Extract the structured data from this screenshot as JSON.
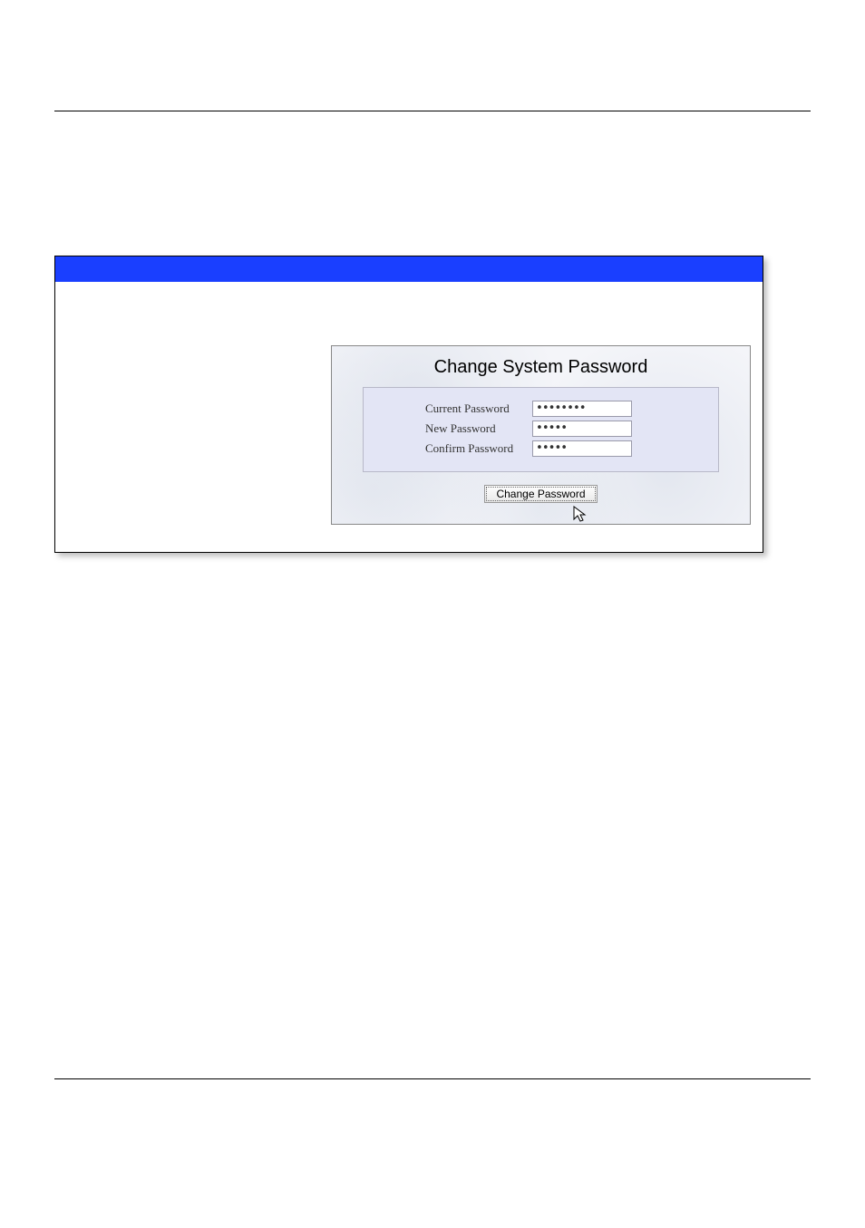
{
  "panel": {
    "title": "Change System Password",
    "fields": {
      "current": {
        "label": "Current Password",
        "value": "••••••••"
      },
      "new": {
        "label": "New Password",
        "value": "•••••"
      },
      "confirm": {
        "label": "Confirm Password",
        "value": "•••••"
      }
    },
    "submit_label": "Change Password"
  }
}
